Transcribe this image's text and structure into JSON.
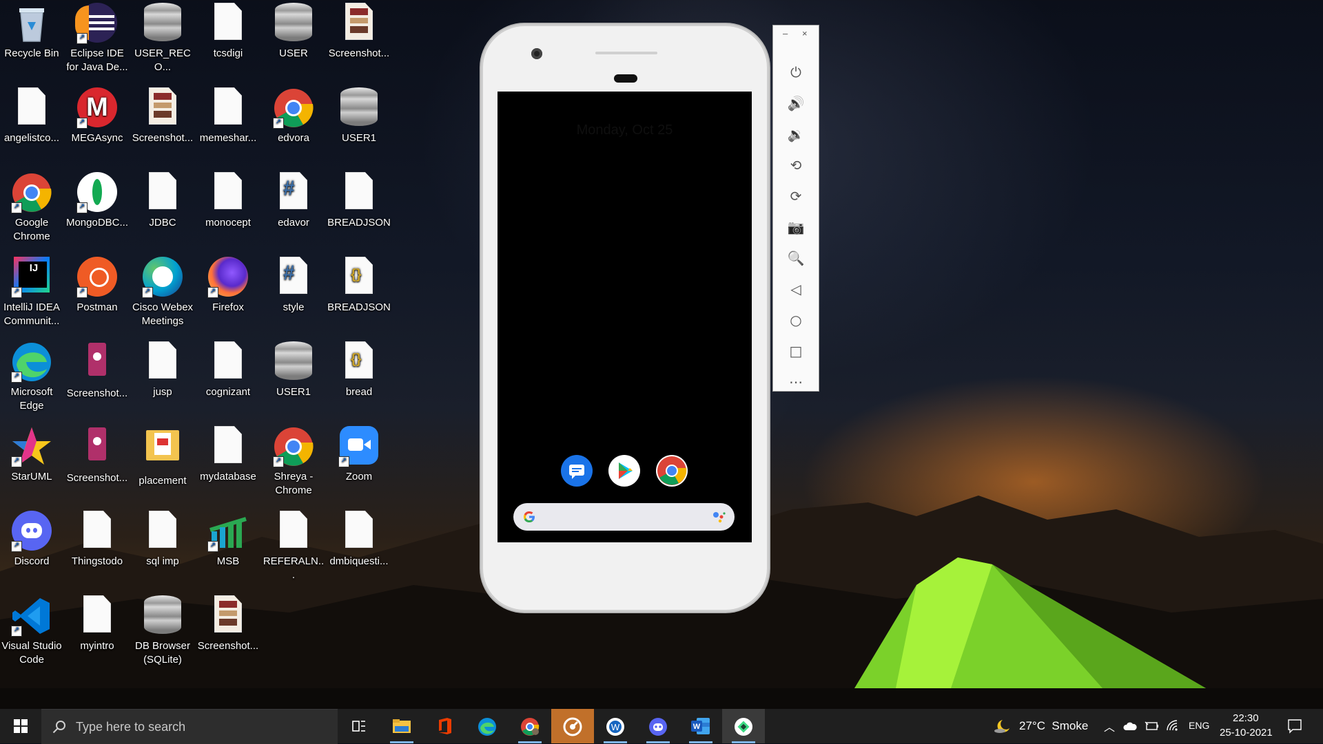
{
  "desktop": {
    "icons": [
      {
        "label": "Recycle Bin",
        "icon": "recycle-bin-icon"
      },
      {
        "label": "Eclipse IDE for Java De...",
        "icon": "eclipse-icon"
      },
      {
        "label": "USER_RECO...",
        "icon": "database-file-icon"
      },
      {
        "label": "tcsdigi",
        "icon": "file-icon"
      },
      {
        "label": "USER",
        "icon": "database-file-icon"
      },
      {
        "label": "Screenshot...",
        "icon": "image-file-icon"
      },
      {
        "label": "angelistco...",
        "icon": "file-icon"
      },
      {
        "label": "MEGAsync",
        "icon": "mega-icon"
      },
      {
        "label": "Screenshot...",
        "icon": "image-file-icon"
      },
      {
        "label": "memeshar...",
        "icon": "file-icon"
      },
      {
        "label": "edvora",
        "icon": "chrome-icon"
      },
      {
        "label": "USER1",
        "icon": "database-file-icon"
      },
      {
        "label": "Google Chrome",
        "icon": "chrome-icon"
      },
      {
        "label": "MongoDBC...",
        "icon": "mongodb-icon"
      },
      {
        "label": "JDBC",
        "icon": "file-icon"
      },
      {
        "label": "monocept",
        "icon": "file-icon"
      },
      {
        "label": "edavor",
        "icon": "csharp-file-icon"
      },
      {
        "label": "BREADJSON",
        "icon": "file-icon"
      },
      {
        "label": "IntelliJ IDEA Communit...",
        "icon": "intellij-icon"
      },
      {
        "label": "Postman",
        "icon": "postman-icon"
      },
      {
        "label": "Cisco Webex Meetings",
        "icon": "webex-icon"
      },
      {
        "label": "Firefox",
        "icon": "firefox-icon"
      },
      {
        "label": "style",
        "icon": "csharp-file-icon"
      },
      {
        "label": "BREADJSON",
        "icon": "json-file-icon"
      },
      {
        "label": "Microsoft Edge",
        "icon": "edge-icon"
      },
      {
        "label": "Screenshot...",
        "icon": "music-file-icon"
      },
      {
        "label": "jusp",
        "icon": "file-icon"
      },
      {
        "label": "cognizant",
        "icon": "file-icon"
      },
      {
        "label": "USER1",
        "icon": "database-file-icon"
      },
      {
        "label": "bread",
        "icon": "json-file-icon"
      },
      {
        "label": "StarUML",
        "icon": "staruml-icon"
      },
      {
        "label": "Screenshot...",
        "icon": "music-file-icon"
      },
      {
        "label": "placement",
        "icon": "folder-icon"
      },
      {
        "label": "mydatabase",
        "icon": "file-icon"
      },
      {
        "label": "Shreya - Chrome",
        "icon": "chrome-icon"
      },
      {
        "label": "Zoom",
        "icon": "zoom-icon"
      },
      {
        "label": "Discord",
        "icon": "discord-icon"
      },
      {
        "label": "Thingstodo",
        "icon": "file-icon"
      },
      {
        "label": "sql imp",
        "icon": "file-icon"
      },
      {
        "label": "MSB",
        "icon": "msb-icon"
      },
      {
        "label": "REFERALN...",
        "icon": "file-icon"
      },
      {
        "label": "dmbiquesti...",
        "icon": "file-icon"
      },
      {
        "label": "Visual Studio Code",
        "icon": "vscode-icon"
      },
      {
        "label": "myintro",
        "icon": "file-icon"
      },
      {
        "label": "DB Browser (SQLite)",
        "icon": "database-file-icon"
      },
      {
        "label": "Screenshot...",
        "icon": "image-file-icon"
      }
    ]
  },
  "emulator": {
    "lock_date": "Monday, Oct 25",
    "dock_apps": [
      "messages-icon",
      "play-store-icon",
      "chrome-icon"
    ],
    "toolbar": {
      "minimize": "–",
      "close": "×",
      "buttons": [
        "power-icon",
        "volume-up-icon",
        "volume-down-icon",
        "rotate-left-icon",
        "rotate-right-icon",
        "camera-icon",
        "zoom-icon",
        "back-icon",
        "home-icon",
        "overview-icon",
        "more-icon"
      ]
    }
  },
  "taskbar": {
    "search_placeholder": "Type here to search",
    "weather": "27°C  Smoke",
    "language": "ENG",
    "time": "22:30",
    "date": "25-10-2021"
  }
}
